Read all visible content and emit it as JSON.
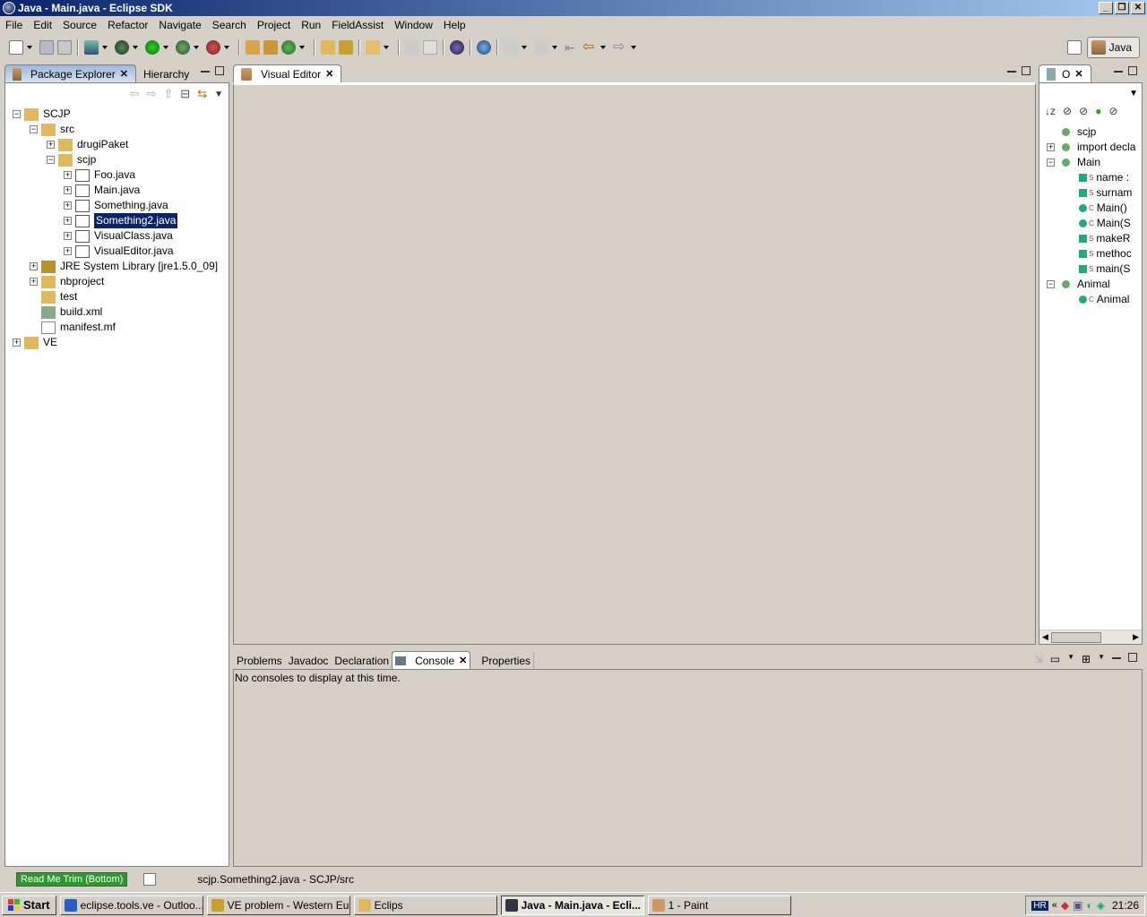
{
  "window": {
    "title": "Java - Main.java - Eclipse SDK"
  },
  "menu": [
    "File",
    "Edit",
    "Source",
    "Refactor",
    "Navigate",
    "Search",
    "Project",
    "Run",
    "FieldAssist",
    "Window",
    "Help"
  ],
  "perspective": {
    "label": "Java"
  },
  "left_panel": {
    "tabs": [
      "Package Explorer",
      "Hierarchy"
    ],
    "tree": [
      {
        "label": "SCJP",
        "indent": 0,
        "pm": "-"
      },
      {
        "label": "src",
        "indent": 1,
        "pm": "-"
      },
      {
        "label": "drugiPaket",
        "indent": 2,
        "pm": "+"
      },
      {
        "label": "scjp",
        "indent": 2,
        "pm": "-"
      },
      {
        "label": "Foo.java",
        "indent": 3,
        "pm": "+"
      },
      {
        "label": "Main.java",
        "indent": 3,
        "pm": "+"
      },
      {
        "label": "Something.java",
        "indent": 3,
        "pm": "+"
      },
      {
        "label": "Something2.java",
        "indent": 3,
        "pm": "+",
        "selected": true
      },
      {
        "label": "VisualClass.java",
        "indent": 3,
        "pm": "+"
      },
      {
        "label": "VisualEditor.java",
        "indent": 3,
        "pm": "+"
      },
      {
        "label": "JRE System Library [jre1.5.0_09]",
        "indent": 1,
        "pm": "+"
      },
      {
        "label": "nbproject",
        "indent": 1,
        "pm": "+"
      },
      {
        "label": "test",
        "indent": 1,
        "pm": ""
      },
      {
        "label": "build.xml",
        "indent": 1,
        "pm": ""
      },
      {
        "label": "manifest.mf",
        "indent": 1,
        "pm": ""
      },
      {
        "label": "VE",
        "indent": 0,
        "pm": "+"
      }
    ]
  },
  "editor": {
    "tab": "Visual Editor"
  },
  "outline": {
    "tab": "O",
    "tree": [
      {
        "label": "scjp",
        "indent": 0,
        "pm": ""
      },
      {
        "label": "import decla",
        "indent": 0,
        "pm": "+"
      },
      {
        "label": "Main",
        "indent": 0,
        "pm": "-"
      },
      {
        "label": "name :",
        "indent": 1,
        "pm": "",
        "mod": "S"
      },
      {
        "label": "surnam",
        "indent": 1,
        "pm": "",
        "mod": "S"
      },
      {
        "label": "Main()",
        "indent": 1,
        "pm": "",
        "mod": "C"
      },
      {
        "label": "Main(S",
        "indent": 1,
        "pm": "",
        "mod": "C"
      },
      {
        "label": "makeR",
        "indent": 1,
        "pm": "",
        "mod": "S"
      },
      {
        "label": "methoc",
        "indent": 1,
        "pm": "",
        "mod": "S"
      },
      {
        "label": "main(S",
        "indent": 1,
        "pm": "",
        "mod": "S"
      },
      {
        "label": "Animal",
        "indent": 0,
        "pm": "-"
      },
      {
        "label": "Animal",
        "indent": 1,
        "pm": "",
        "mod": "C"
      }
    ]
  },
  "bottom": {
    "tabs": [
      "Problems",
      "Javadoc",
      "Declaration",
      "Console",
      "Properties"
    ],
    "active": "Console",
    "message": "No consoles to display at this time."
  },
  "status": {
    "trim_label": "Read Me Trim (Bottom)",
    "path": "scjp.Something2.java - SCJP/src"
  },
  "taskbar": {
    "start": "Start",
    "tasks": [
      "eclipse.tools.ve - Outloo...",
      "VE problem - Western Eu...",
      "Eclips",
      "Java - Main.java - Ecli...",
      "1 - Paint"
    ],
    "active_index": 3,
    "lang": "HR",
    "clock": "21:26"
  }
}
